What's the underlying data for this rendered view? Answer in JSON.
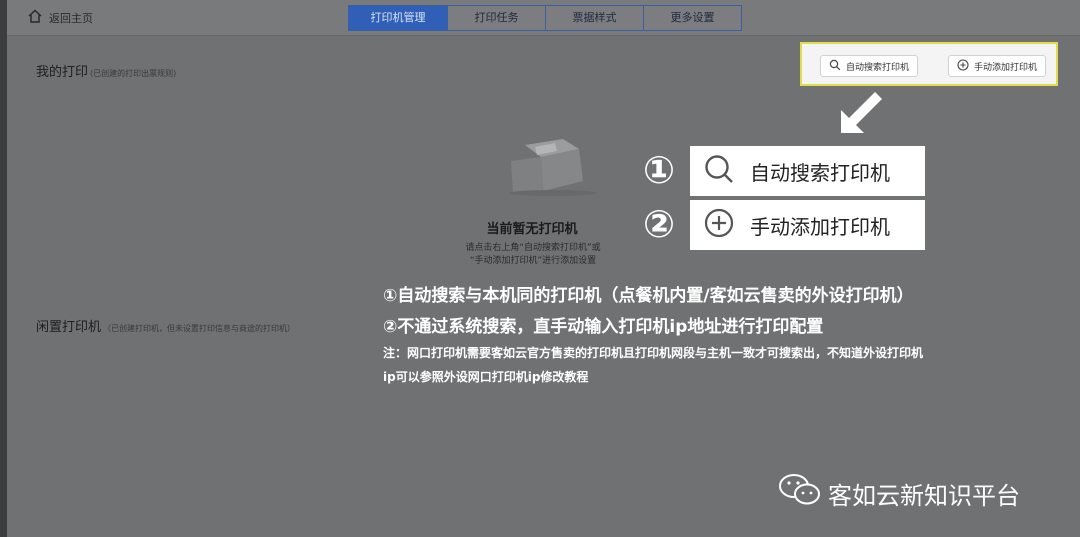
{
  "topbar": {
    "home_label": "返回主页",
    "tabs": [
      {
        "label": "打印机管理",
        "active": true
      },
      {
        "label": "打印任务",
        "active": false
      },
      {
        "label": "票据样式",
        "active": false
      },
      {
        "label": "更多设置",
        "active": false
      }
    ]
  },
  "my_printers": {
    "title": "我的打印",
    "subtitle": "(已创建的打印出票规则)",
    "search_button": "自动搜索打印机",
    "add_button": "手动添加打印机",
    "empty_title": "当前暂无打印机",
    "empty_hint_line1": "请点击右上角“自动搜索打印机”或",
    "empty_hint_line2": "“手动添加打印机”进行添加设置"
  },
  "idle_printers": {
    "title": "闲置打印机",
    "subtitle": "（已创建打印机，但未设置打印信息与商途的打印机）"
  },
  "callouts": {
    "num1": "①",
    "num2": "②",
    "search_label": "自动搜索打印机",
    "add_label": "手动添加打印机"
  },
  "notes": {
    "line1": "①自动搜索与本机同的打印机（点餐机内置/客如云售卖的外设打印机）",
    "line2": "②不通过系统搜索，直手动输入打印机ip地址进行打印配置",
    "line3": "注：网口打印机需要客如云官方售卖的打印机且打印机网段与主机一致才可搜索出，不知道外设打印机",
    "line4": "ip可以参照外设网口打印机ip修改教程"
  },
  "watermark": "客如云新知识平台",
  "colors": {
    "active_tab": "#2f5fb6",
    "highlight_border": "#e3dc4a",
    "overlay": "#6f7173"
  }
}
